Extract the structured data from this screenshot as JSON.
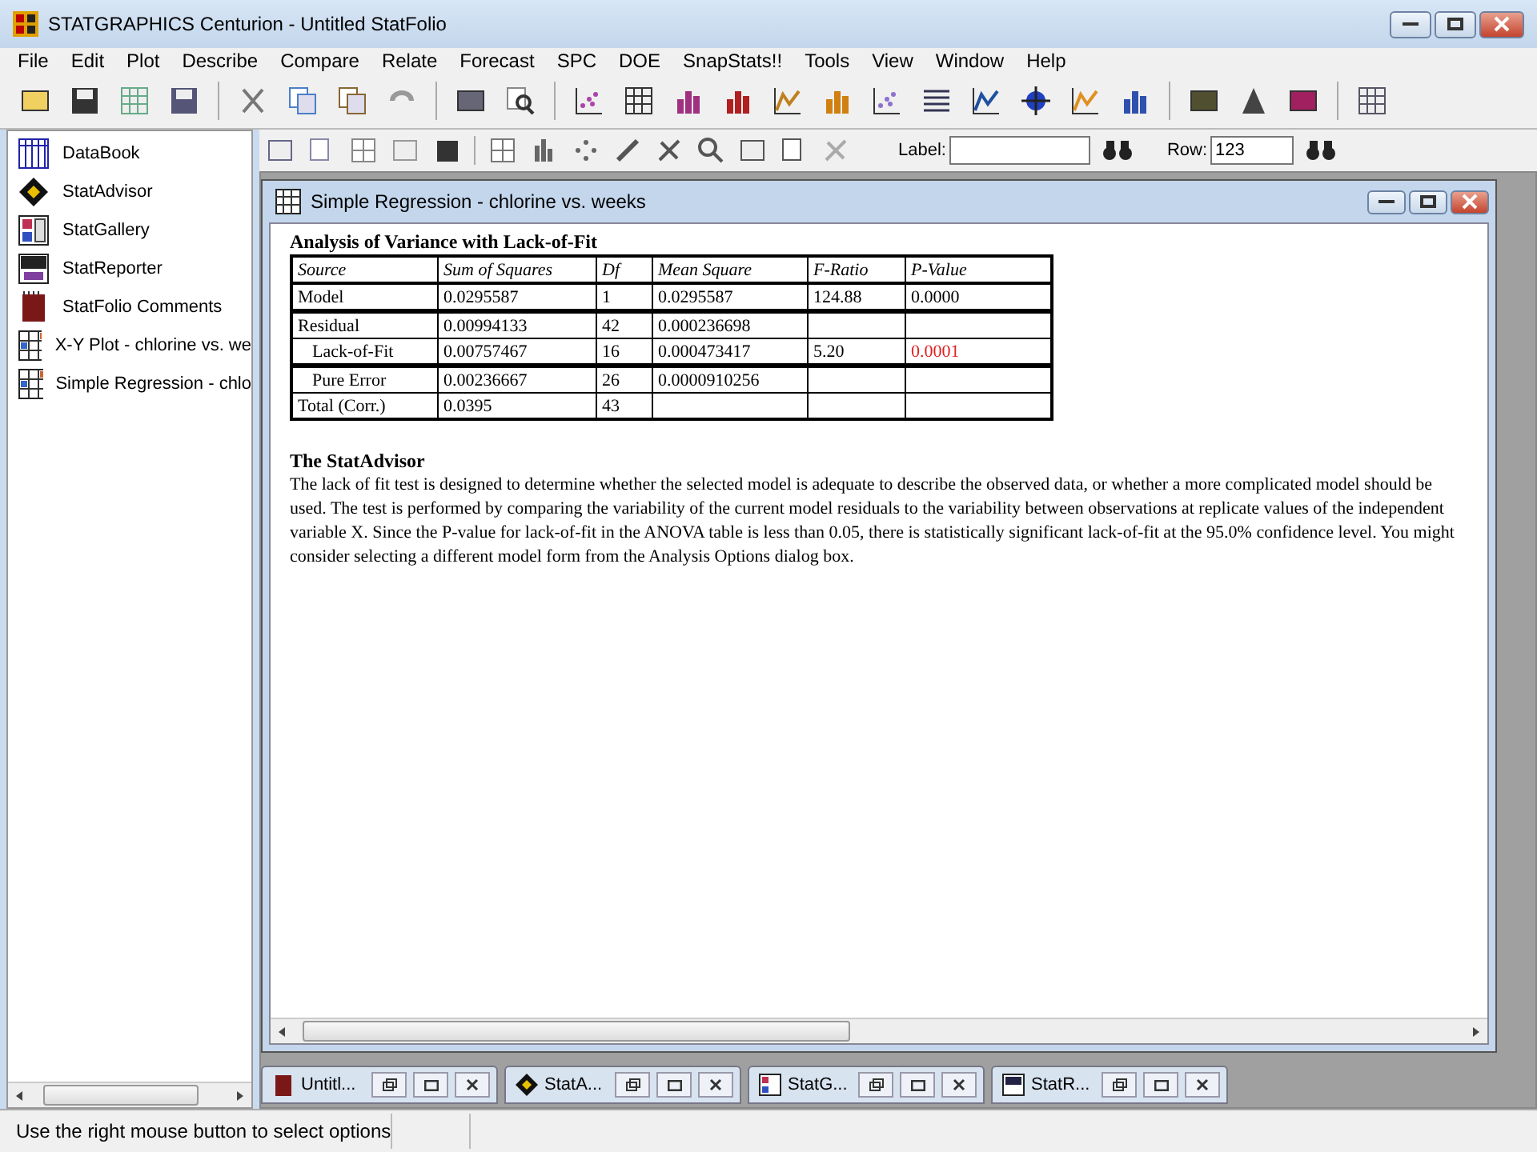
{
  "app_window": {
    "title": "STATGRAPHICS Centurion - Untitled StatFolio"
  },
  "menu": [
    "File",
    "Edit",
    "Plot",
    "Describe",
    "Compare",
    "Relate",
    "Forecast",
    "SPC",
    "DOE",
    "SnapStats!!",
    "Tools",
    "View",
    "Window",
    "Help"
  ],
  "find_bar": {
    "label_caption": "Label:",
    "row_caption": "Row:",
    "row_value": "123"
  },
  "sidebar": {
    "items": [
      {
        "label": "DataBook",
        "kind": "databook"
      },
      {
        "label": "StatAdvisor",
        "kind": "advisor"
      },
      {
        "label": "StatGallery",
        "kind": "gallery"
      },
      {
        "label": "StatReporter",
        "kind": "reporter"
      },
      {
        "label": "StatFolio Comments",
        "kind": "comments"
      },
      {
        "label": "X-Y Plot - chlorine vs. we",
        "kind": "analysis"
      },
      {
        "label": "Simple Regression - chlo",
        "kind": "analysis"
      }
    ]
  },
  "document_window": {
    "title": "Simple Regression - chlorine vs. weeks",
    "table": {
      "title": "Analysis of Variance with Lack-of-Fit",
      "columns": [
        "Source",
        "Sum of Squares",
        "Df",
        "Mean Square",
        "F-Ratio",
        "P-Value"
      ],
      "rows": [
        {
          "source": "Model",
          "sum_of_squares": "0.0295587",
          "df": "1",
          "mean_square": "0.0295587",
          "f_ratio": "124.88",
          "p_value": "0.0000",
          "indented": false,
          "divider_above": false,
          "significant": false
        },
        {
          "source": "Residual",
          "sum_of_squares": "0.00994133",
          "df": "42",
          "mean_square": "0.000236698",
          "indented": false,
          "divider_above": true
        },
        {
          "source": "Lack-of-Fit",
          "sum_of_squares": "0.00757467",
          "df": "16",
          "mean_square": "0.000473417",
          "f_ratio": "5.20",
          "p_value": "0.0001",
          "indented": true,
          "divider_above": false,
          "significant": true
        },
        {
          "source": "Pure Error",
          "sum_of_squares": "0.00236667",
          "df": "26",
          "mean_square": "0.0000910256",
          "indented": true,
          "divider_above": true
        },
        {
          "source": "Total (Corr.)",
          "sum_of_squares": "0.0395",
          "df": "43",
          "indented": false,
          "divider_above": false
        }
      ]
    },
    "advisor": {
      "heading": "The StatAdvisor",
      "text": "The lack of fit test is designed to determine whether the selected model is adequate to describe the observed data, or whether a more complicated model should be used.  The test is performed by comparing the variability of the current model residuals to the variability between observations at replicate values of the independent variable X.  Since the P-value for lack-of-fit in the ANOVA table is less than 0.05, there is statistically significant lack-of-fit at the 95.0% confidence level.  You might consider selecting a different model form from the Analysis Options dialog box."
    }
  },
  "taskbar": [
    {
      "label": "Untitl...",
      "kind": "comments"
    },
    {
      "label": "StatA...",
      "kind": "advisor"
    },
    {
      "label": "StatG...",
      "kind": "gallery"
    },
    {
      "label": "StatR...",
      "kind": "reporter"
    }
  ],
  "status_bar": {
    "message": "Use the right mouse button to select options"
  }
}
